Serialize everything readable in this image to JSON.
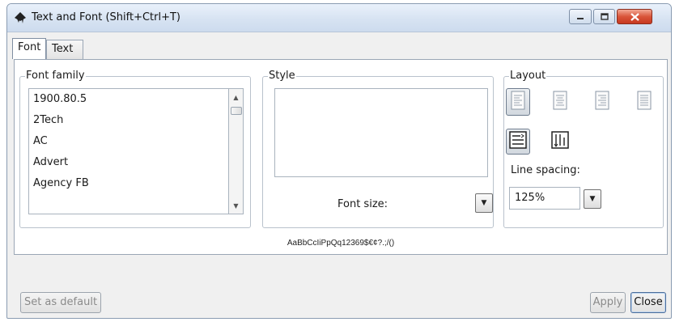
{
  "window": {
    "title": "Text and Font (Shift+Ctrl+T)",
    "app_icon": "inkscape-logo",
    "controls": [
      "minimize-icon",
      "maximize-icon",
      "close-icon"
    ]
  },
  "tabs": [
    {
      "label": "Font",
      "selected": true
    },
    {
      "label": "Text",
      "selected": false
    }
  ],
  "font_family": {
    "label": "Font family",
    "items": [
      "1900.80.5",
      "2Tech",
      "AC",
      "Advert",
      "Agency FB"
    ]
  },
  "style": {
    "label": "Style",
    "font_size_label": "Font size:",
    "font_size_value": ""
  },
  "layout": {
    "label": "Layout",
    "alignment_buttons": [
      "align-left-icon",
      "align-center-icon",
      "align-right-icon",
      "justify-icon"
    ],
    "selected_alignment": "align-left-icon",
    "mode_buttons": [
      "horizontal-text-icon",
      "vertical-text-icon"
    ],
    "selected_mode": "horizontal-text-icon",
    "line_spacing_label": "Line spacing:",
    "line_spacing_value": "125%"
  },
  "preview_text": "AaBbCcIiPpQq12369$€¢?.;/()",
  "buttons": {
    "set_default": "Set as default",
    "apply": "Apply",
    "close": "Close"
  }
}
